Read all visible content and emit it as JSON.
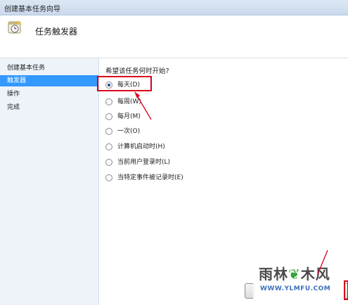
{
  "window": {
    "title": "创建基本任务向导"
  },
  "header": {
    "title": "任务触发器",
    "icon": "clock-task-icon"
  },
  "sidebar": {
    "items": [
      {
        "label": "创建基本任务",
        "active": false
      },
      {
        "label": "触发器",
        "active": true
      },
      {
        "label": "操作",
        "active": false
      },
      {
        "label": "完成",
        "active": false
      }
    ]
  },
  "main": {
    "question": "希望该任务何时开始?",
    "options": [
      {
        "label": "每天(D)",
        "selected": true
      },
      {
        "label": "每周(W)",
        "selected": false
      },
      {
        "label": "每月(M)",
        "selected": false
      },
      {
        "label": "一次(O)",
        "selected": false
      },
      {
        "label": "计算机启动时(H)",
        "selected": false
      },
      {
        "label": "当前用户登录时(L)",
        "selected": false
      },
      {
        "label": "当特定事件被记录时(E)",
        "selected": false
      }
    ]
  },
  "watermark": {
    "text_left": "雨林",
    "text_right": "木风",
    "url": "WWW.YLMFU.COM"
  },
  "colors": {
    "selection": "#3399ff",
    "highlight_box": "#d8001c",
    "sidebar_bg": "#eef3fa"
  }
}
